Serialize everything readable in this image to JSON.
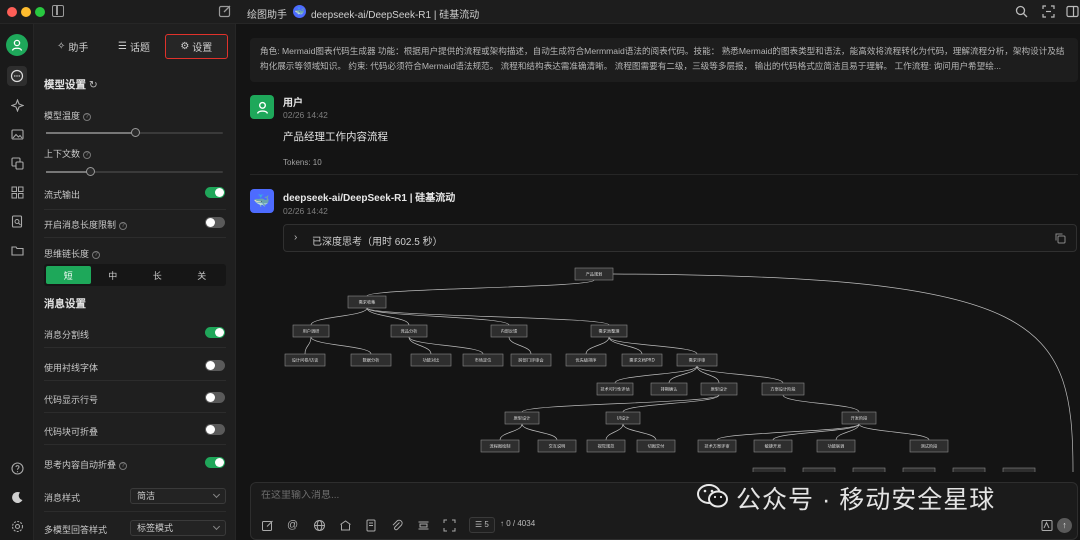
{
  "titlebar": {
    "assistant_tab": "绘图助手",
    "model_title": "deepseek-ai/DeepSeek-R1 | 硅基流动",
    "model_avatar_glyph": "🐳"
  },
  "settings": {
    "tabs": [
      {
        "label": "助手",
        "icon": "sparkle-icon"
      },
      {
        "label": "话题",
        "icon": "list-icon"
      },
      {
        "label": "设置",
        "icon": "gear-icon",
        "active": true
      }
    ],
    "model_section": "模型设置",
    "temperature_label": "模型温度",
    "temperature_level": 0.5,
    "context_label": "上下文数",
    "context_level": 0.25,
    "stream_label": "流式输出",
    "stream_on": true,
    "length_limit_label": "开启消息长度限制",
    "length_limit_on": false,
    "reasoning_label": "思维链长度",
    "reasoning_options": [
      "短",
      "中",
      "长",
      "关"
    ],
    "reasoning_selected": "短",
    "message_section": "消息设置",
    "toggles": [
      {
        "label": "消息分割线",
        "on": true
      },
      {
        "label": "使用衬线字体",
        "on": false
      },
      {
        "label": "代码显示行号",
        "on": false
      },
      {
        "label": "代码块可折叠",
        "on": false
      },
      {
        "label": "思考内容自动折叠",
        "on": true,
        "help": true
      }
    ],
    "message_style_label": "消息样式",
    "message_style_value": "简洁",
    "multi_model_label": "多模型回答样式",
    "multi_model_value": "标签模式"
  },
  "system_prompt": "角色: Mermaid图表代码生成器 功能：根据用户提供的流程或架构描述，自动生成符合Mermmaid语法的阅表代码。技能： 熟悉Mermaid的图表类型和语法，能高效将流程转化为代码，理解流程分析，架构设计及结构化展示等领域知识。 约束: 代码必须符合Mermaid语法规范。 流程和结构表达需准确清晰。 流程图需要有二级，三级等多层报，  输出的代码格式应简洁且易于理解。 工作流程: 询问用户希望绘...",
  "user_message": {
    "name": "用户",
    "time": "02/26 14:42",
    "text": "产品经理工作内容流程",
    "tokens": "Tokens: 10"
  },
  "ai_message": {
    "name": "deepseek-ai/DeepSeek-R1 | 硅基流动",
    "time": "02/26 14:42",
    "thinking": "已深度思考（用时 602.5 秒）"
  },
  "flowchart": {
    "root": "产品规划",
    "l1": [
      "需求收集"
    ],
    "l2": [
      "用户调研",
      "竞品分析",
      "内部反馈",
      "需求池整理"
    ],
    "l3": [
      "设计问卷/访谈",
      "数据分析",
      "功能对比",
      "市场定位",
      "跨部门评审会",
      "优先级排序",
      "需求文档PRD",
      "需求评审"
    ],
    "l4": [
      "技术可行性评估",
      "排期确认",
      "原型设计",
      "方案设计阶段"
    ],
    "l5": [
      "原型设计",
      "UI设计",
      "开发阶段"
    ],
    "l6": [
      "流程图绘制",
      "交互说明",
      "视觉规范",
      "切图交付",
      "技术方案评审",
      "敏捷开发",
      "功能联调",
      "测试阶段"
    ]
  },
  "composer": {
    "placeholder": "在这里输入消息...",
    "context_count": "5",
    "token_count": "↑ 0 / 4034"
  },
  "watermark": "公众号 · 移动安全星球"
}
